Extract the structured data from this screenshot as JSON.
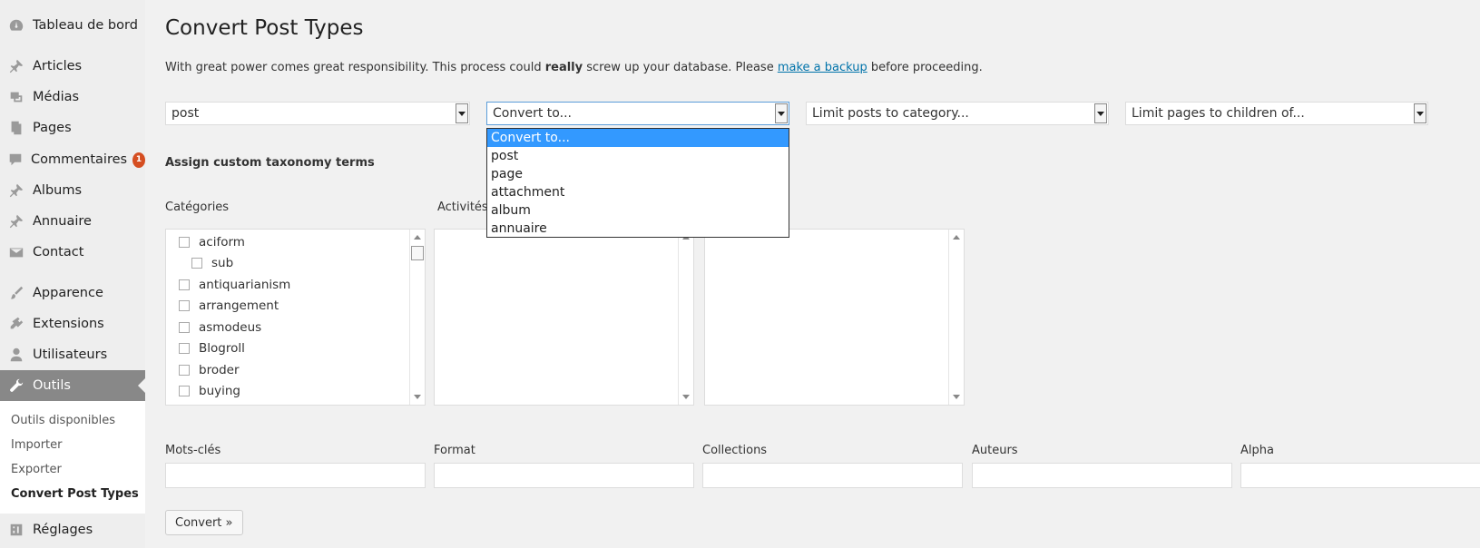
{
  "sidebar": {
    "items": [
      {
        "label": "Tableau de bord",
        "icon": "dashboard-icon"
      },
      {
        "label": "Articles",
        "icon": "pin-icon"
      },
      {
        "label": "Médias",
        "icon": "media-icon"
      },
      {
        "label": "Pages",
        "icon": "pages-icon"
      },
      {
        "label": "Commentaires",
        "icon": "comment-icon",
        "badge": "1"
      },
      {
        "label": "Albums",
        "icon": "pin-icon"
      },
      {
        "label": "Annuaire",
        "icon": "pin-icon"
      },
      {
        "label": "Contact",
        "icon": "mail-icon"
      },
      {
        "label": "Apparence",
        "icon": "brush-icon"
      },
      {
        "label": "Extensions",
        "icon": "plugin-icon"
      },
      {
        "label": "Utilisateurs",
        "icon": "user-icon"
      },
      {
        "label": "Outils",
        "icon": "wrench-icon"
      },
      {
        "label": "Réglages",
        "icon": "settings-icon"
      }
    ],
    "submenu": [
      "Outils disponibles",
      "Importer",
      "Exporter",
      "Convert Post Types"
    ]
  },
  "page": {
    "title": "Convert Post Types",
    "intro_before": "With great power comes great responsibility. This process could ",
    "intro_bold": "really",
    "intro_middle": " screw up your database. Please ",
    "intro_link": "make a backup",
    "intro_after": " before proceeding."
  },
  "selects": {
    "from": "post",
    "to": "Convert to...",
    "category": "Limit posts to category...",
    "parent": "Limit pages to children of..."
  },
  "dropdown": {
    "options": [
      "Convert to...",
      "post",
      "page",
      "attachment",
      "album",
      "annuaire"
    ],
    "selected": "Convert to..."
  },
  "taxonomy": {
    "heading": "Assign custom taxonomy terms",
    "box_labels": [
      "Catégories",
      "Activités"
    ],
    "categories": [
      "aciform",
      "sub",
      "antiquarianism",
      "arrangement",
      "asmodeus",
      "Blogroll",
      "broder",
      "buying"
    ]
  },
  "fields": {
    "labels": [
      "Mots-clés",
      "Format",
      "Collections",
      "Auteurs",
      "Alpha"
    ]
  },
  "button": {
    "label": "Convert »"
  },
  "colors": {
    "active_menu": "#888888",
    "badge": "#d54e21",
    "link": "#0073aa",
    "highlight": "#3399ff"
  }
}
